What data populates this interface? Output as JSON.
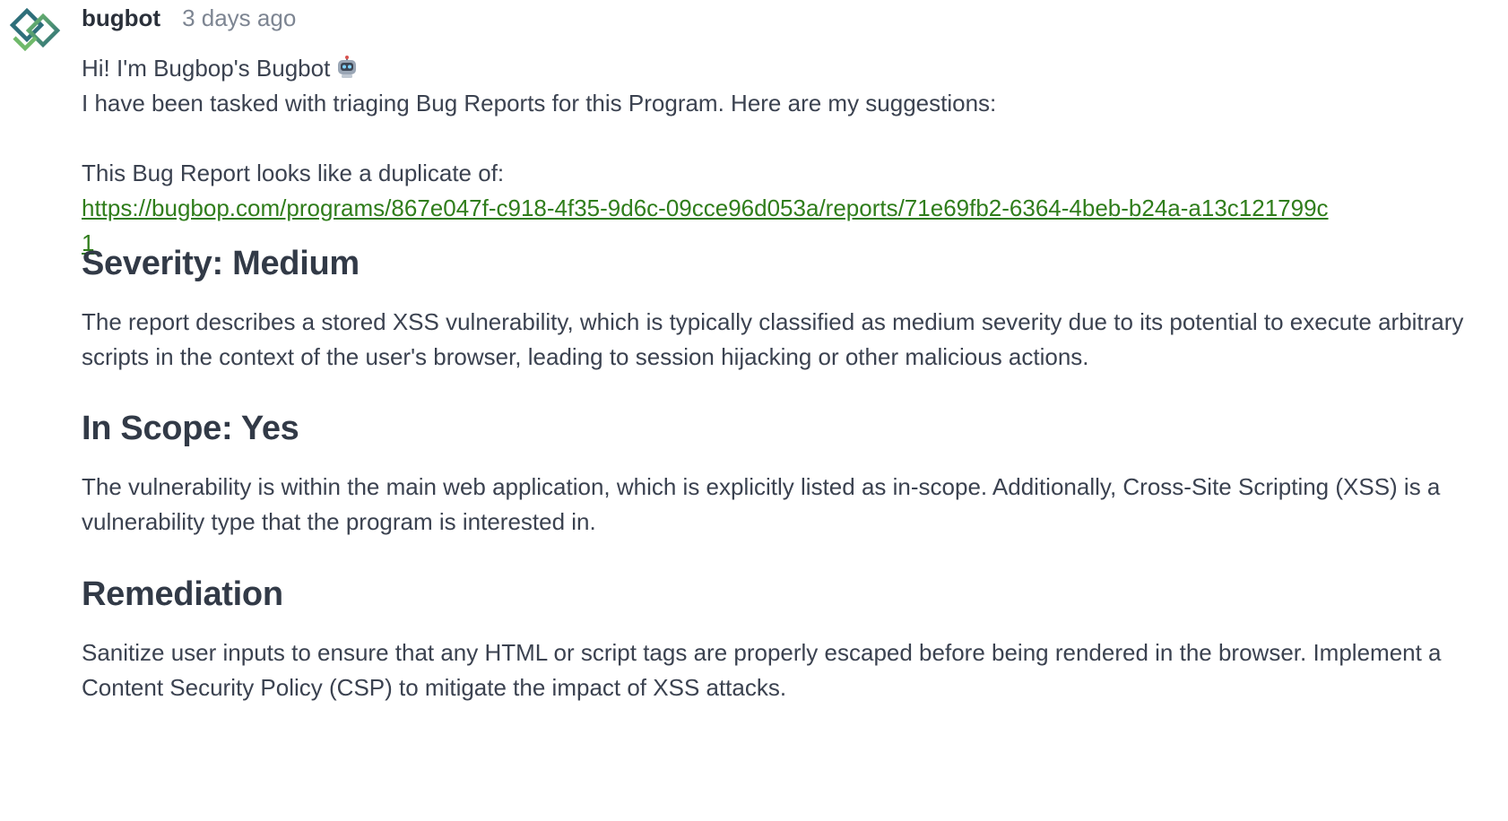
{
  "comment": {
    "author": "bugbot",
    "timestamp": "3 days ago",
    "avatar_icon": "bugbop-diamond-logo-icon",
    "greeting": "Hi! I'm Bugbop's Bugbot",
    "greeting_icon": "robot-icon",
    "intro": "I have been tasked with triaging Bug Reports for this Program. Here are my suggestions:",
    "duplicate_label": "This Bug Report looks like a duplicate of:",
    "duplicate_link": "https://bugbop.com/programs/867e047f-c918-4f35-9d6c-09cce96d053a/reports/71e69fb2-6364-4beb-b24a-a13c121799c1",
    "sections": [
      {
        "heading": "Severity: Medium",
        "text": "The report describes a stored XSS vulnerability, which is typically classified as medium severity due to its potential to execute arbitrary scripts in the context of the user's browser, leading to session hijacking or other malicious actions."
      },
      {
        "heading": "In Scope: Yes",
        "text": "The vulnerability is within the main web application, which is explicitly listed as in-scope. Additionally, Cross-Site Scripting (XSS) is a vulnerability type that the program is interested in."
      },
      {
        "heading": "Remediation",
        "text": "Sanitize user inputs to ensure that any HTML or script tags are properly escaped before being rendered in the browser. Implement a Content Security Policy (CSP) to mitigate the impact of XSS attacks."
      }
    ]
  },
  "colors": {
    "link": "#2f7d1b",
    "text": "#3b4250",
    "muted": "#7d8592",
    "logo_green": "#5aa65a",
    "logo_teal": "#2e6f7a"
  }
}
